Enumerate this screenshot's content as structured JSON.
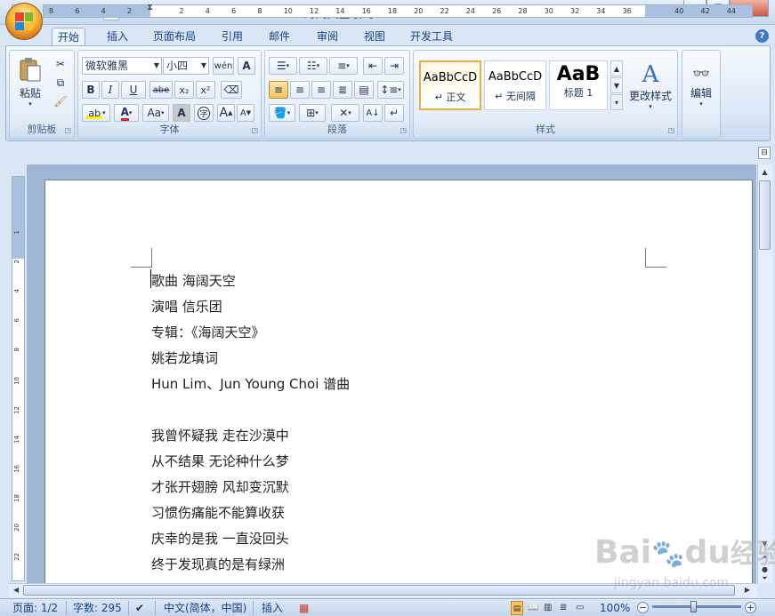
{
  "window": {
    "title": "海阔天空歌词 - Microsoft Word",
    "minimize": "—",
    "restore": "❐",
    "close": "✕"
  },
  "qat": {
    "undo": "↶",
    "redo": "↻",
    "print_preview": "⎙",
    "more": "▾"
  },
  "tabs": [
    "开始",
    "插入",
    "页面布局",
    "引用",
    "邮件",
    "审阅",
    "视图",
    "开发工具"
  ],
  "ribbon": {
    "clipboard": {
      "label": "剪贴板",
      "paste": "粘贴"
    },
    "font": {
      "label": "字体",
      "font_name": "微软雅黑",
      "font_size": "小四",
      "bold": "B",
      "italic": "I",
      "underline": "U",
      "strike": "abe",
      "subscript": "x₂",
      "superscript": "x²",
      "font_color": "A",
      "case": "Aa",
      "grow": "A",
      "shrink": "A",
      "phonetic": "wén",
      "char_border": "A",
      "char_shade": "A",
      "enclose": "字"
    },
    "paragraph": {
      "label": "段落"
    },
    "styles": {
      "label": "样式",
      "items": [
        {
          "sample": "AaBbCcD",
          "name": "↵ 正文"
        },
        {
          "sample": "AaBbCcD",
          "name": "↵ 无间隔"
        },
        {
          "sample": "AaB",
          "name": "标题 1"
        }
      ],
      "change_styles": "更改样式"
    },
    "editing": {
      "label": "编辑"
    }
  },
  "ruler": {
    "ticks": [
      "8",
      "6",
      "4",
      "2",
      "",
      "2",
      "4",
      "6",
      "8",
      "10",
      "12",
      "14",
      "16",
      "18",
      "20",
      "22",
      "24",
      "26",
      "28",
      "30",
      "32",
      "34",
      "36",
      "",
      "40",
      "42",
      "44"
    ]
  },
  "vruler": {
    "ticks": [
      "1",
      "2",
      "4",
      "6",
      "8",
      "10",
      "12",
      "14",
      "16",
      "18",
      "20",
      "22"
    ]
  },
  "document": {
    "lines": [
      "歌曲 海阔天空",
      "演唱 信乐团",
      "专辑：《海阔天空》",
      "姚若龙填词",
      "Hun Lim、Jun Young Choi 谱曲",
      "",
      "我曾怀疑我 走在沙漠中",
      "从不结果 无论种什么梦",
      "才张开翅膀 风却变沉默",
      "习惯伤痛能不能算收获",
      "庆幸的是我 一直没回头",
      "终于发现真的是有绿洲"
    ]
  },
  "status": {
    "page": "页面: 1/2",
    "words": "字数: 295",
    "language": "中文(简体，中国)",
    "mode": "插入",
    "zoom": "100%"
  },
  "watermark": {
    "brand": "Bai",
    "paw": "du",
    "cn": "经验",
    "url": "jingyan.baidu.com"
  },
  "colors": {
    "accent": "#15428b",
    "ribbon_bg": "#dbe6f4",
    "highlight": "#f6c35c"
  }
}
